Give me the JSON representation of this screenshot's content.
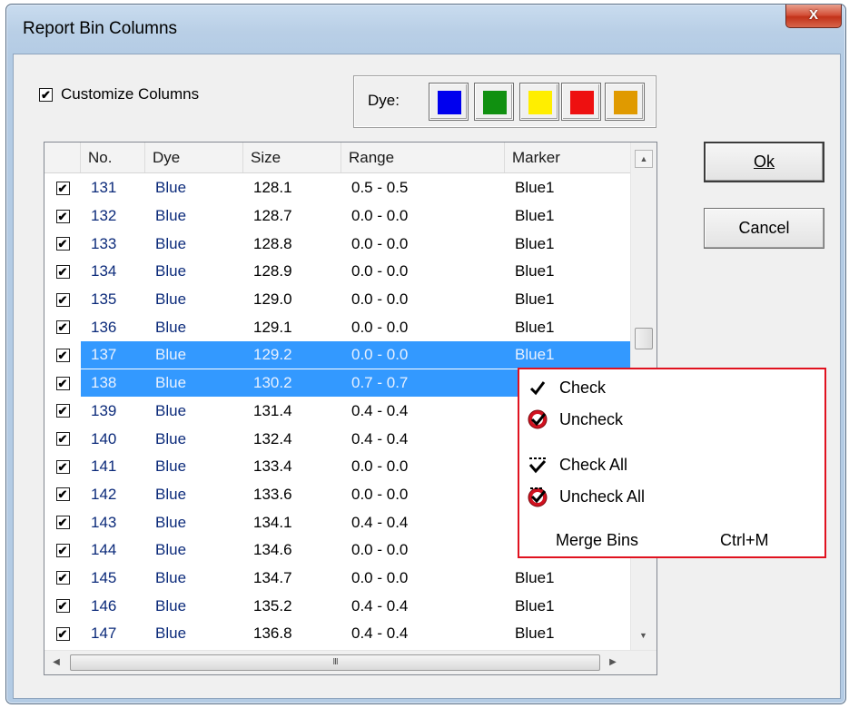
{
  "window": {
    "title": "Report Bin Columns",
    "close_label": "X"
  },
  "customize": {
    "label": "Customize Columns",
    "checked": true,
    "check_glyph": "✔"
  },
  "dye": {
    "label": "Dye:",
    "swatches": [
      {
        "name": "blue",
        "color": "#0000ee"
      },
      {
        "name": "green",
        "color": "#109010"
      },
      {
        "name": "yellow",
        "color": "#ffee00"
      },
      {
        "name": "red",
        "color": "#ee1010"
      },
      {
        "name": "orange",
        "color": "#e09a00"
      }
    ]
  },
  "table": {
    "headers": [
      "No.",
      "Dye",
      "Size",
      "Range",
      "Marker"
    ],
    "rows": [
      {
        "no": "131",
        "dye": "Blue",
        "size": "128.1",
        "range": "0.5 - 0.5",
        "marker": "Blue1"
      },
      {
        "no": "132",
        "dye": "Blue",
        "size": "128.7",
        "range": "0.0 - 0.0",
        "marker": "Blue1"
      },
      {
        "no": "133",
        "dye": "Blue",
        "size": "128.8",
        "range": "0.0 - 0.0",
        "marker": "Blue1"
      },
      {
        "no": "134",
        "dye": "Blue",
        "size": "128.9",
        "range": "0.0 - 0.0",
        "marker": "Blue1"
      },
      {
        "no": "135",
        "dye": "Blue",
        "size": "129.0",
        "range": "0.0 - 0.0",
        "marker": "Blue1"
      },
      {
        "no": "136",
        "dye": "Blue",
        "size": "129.1",
        "range": "0.0 - 0.0",
        "marker": "Blue1"
      },
      {
        "no": "137",
        "dye": "Blue",
        "size": "129.2",
        "range": "0.0 - 0.0",
        "marker": "Blue1",
        "selected": true
      },
      {
        "no": "138",
        "dye": "Blue",
        "size": "130.2",
        "range": "0.7 - 0.7",
        "marker": "",
        "selected": true
      },
      {
        "no": "139",
        "dye": "Blue",
        "size": "131.4",
        "range": "0.4 - 0.4",
        "marker": ""
      },
      {
        "no": "140",
        "dye": "Blue",
        "size": "132.4",
        "range": "0.4 - 0.4",
        "marker": ""
      },
      {
        "no": "141",
        "dye": "Blue",
        "size": "133.4",
        "range": "0.0 - 0.0",
        "marker": ""
      },
      {
        "no": "142",
        "dye": "Blue",
        "size": "133.6",
        "range": "0.0 - 0.0",
        "marker": ""
      },
      {
        "no": "143",
        "dye": "Blue",
        "size": "134.1",
        "range": "0.4 - 0.4",
        "marker": ""
      },
      {
        "no": "144",
        "dye": "Blue",
        "size": "134.6",
        "range": "0.0 - 0.0",
        "marker": ""
      },
      {
        "no": "145",
        "dye": "Blue",
        "size": "134.7",
        "range": "0.0 - 0.0",
        "marker": "Blue1"
      },
      {
        "no": "146",
        "dye": "Blue",
        "size": "135.2",
        "range": "0.4 - 0.4",
        "marker": "Blue1"
      },
      {
        "no": "147",
        "dye": "Blue",
        "size": "136.8",
        "range": "0.4 - 0.4",
        "marker": "Blue1"
      }
    ],
    "hscroll_grip": "III"
  },
  "buttons": {
    "ok": "Ok",
    "cancel": "Cancel"
  },
  "context_menu": {
    "items": [
      {
        "label": "Check",
        "icon": "checkmark-icon",
        "shortcut": ""
      },
      {
        "label": "Uncheck",
        "icon": "uncheck-icon",
        "shortcut": ""
      },
      {
        "label": "Check All",
        "icon": "check-all-icon",
        "shortcut": ""
      },
      {
        "label": "Uncheck All",
        "icon": "uncheck-all-icon",
        "shortcut": ""
      },
      {
        "label": "Merge Bins",
        "icon": "",
        "shortcut": "Ctrl+M"
      }
    ],
    "border_color": "#e0121f"
  }
}
